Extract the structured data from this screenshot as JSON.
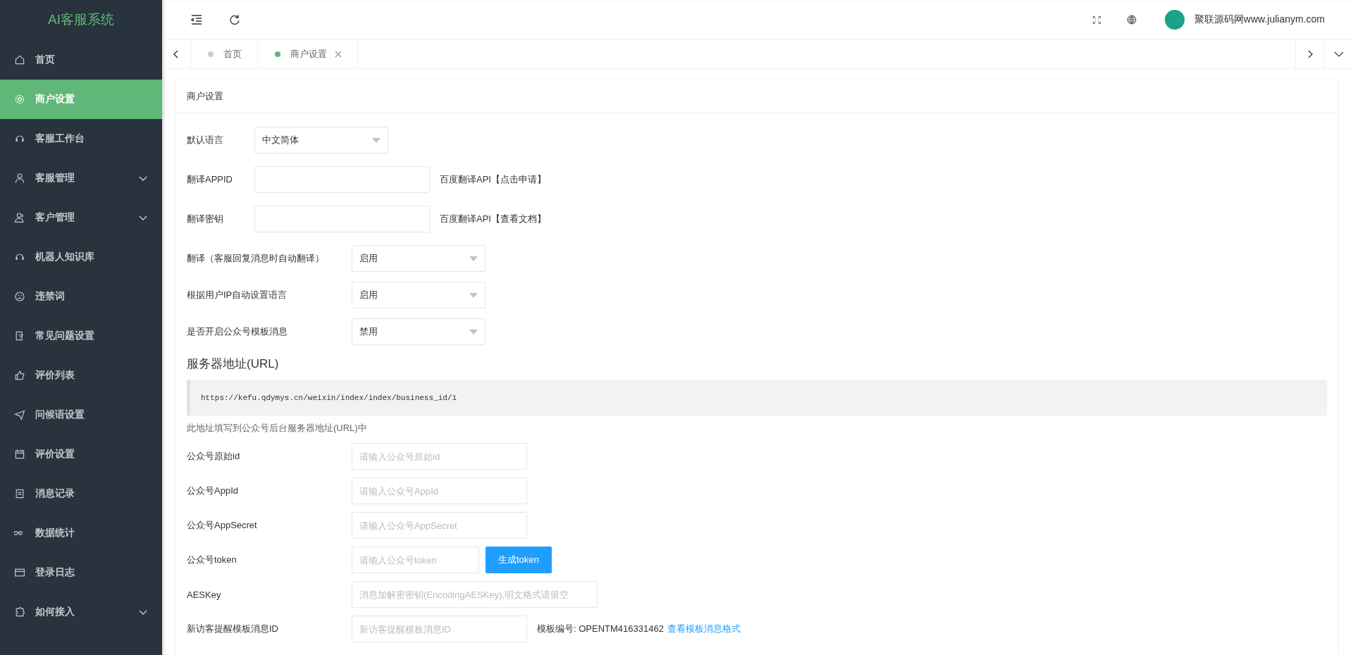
{
  "sidebar": {
    "title": "AI客服系统",
    "items": [
      {
        "label": "首页",
        "selected": false,
        "has_submenu": false
      },
      {
        "label": "商户设置",
        "selected": true,
        "has_submenu": false
      },
      {
        "label": "客服工作台",
        "selected": false,
        "has_submenu": false
      },
      {
        "label": "客服管理",
        "selected": false,
        "has_submenu": true
      },
      {
        "label": "客户管理",
        "selected": false,
        "has_submenu": true
      },
      {
        "label": "机器人知识库",
        "selected": false,
        "has_submenu": false
      },
      {
        "label": "违禁词",
        "selected": false,
        "has_submenu": false
      },
      {
        "label": "常见问题设置",
        "selected": false,
        "has_submenu": false
      },
      {
        "label": "评价列表",
        "selected": false,
        "has_submenu": false
      },
      {
        "label": "问候语设置",
        "selected": false,
        "has_submenu": false
      },
      {
        "label": "评价设置",
        "selected": false,
        "has_submenu": false
      },
      {
        "label": "消息记录",
        "selected": false,
        "has_submenu": false
      },
      {
        "label": "数据统计",
        "selected": false,
        "has_submenu": false
      },
      {
        "label": "登录日志",
        "selected": false,
        "has_submenu": false
      },
      {
        "label": "如何接入",
        "selected": false,
        "has_submenu": true
      }
    ]
  },
  "header": {
    "user_name": "聚联源码网www.julianym.com"
  },
  "tabs": [
    {
      "label": "首页",
      "selected": false,
      "closable": false
    },
    {
      "label": "商户设置",
      "selected": true,
      "closable": true
    }
  ],
  "card": {
    "title": "商户设置",
    "translation_settings": [
      {
        "kind": "select",
        "label": "默认语言",
        "value": "中文简体"
      },
      {
        "kind": "input",
        "label": "翻译APPID",
        "note": "百度翻译API【点击申请】"
      },
      {
        "kind": "input",
        "label": "翻译密钥",
        "note": "百度翻译API【查看文档】"
      }
    ],
    "toggle_settings": [
      {
        "label": "翻译（客服回复消息时自动翻译）",
        "value": "启用"
      },
      {
        "label": "根据用户IP自动设置语言",
        "value": "启用"
      },
      {
        "label": "是否开启公众号模板消息",
        "value": "禁用"
      }
    ],
    "server_url": {
      "heading": "服务器地址(URL)",
      "url": "https://kefu.qdymys.cn/weixin/index/index/business_id/1",
      "hint": "此地址填写到公众号后台服务器地址(URL)中"
    },
    "wechat_fields": [
      {
        "kind": "input",
        "label": "公众号原始id",
        "placeholder": "请输入公众号原始id"
      },
      {
        "kind": "input",
        "label": "公众号AppId",
        "placeholder": "请输入公众号AppId"
      },
      {
        "kind": "input",
        "label": "公众号AppSecret",
        "placeholder": "请输入公众号AppSecret"
      },
      {
        "kind": "input_button",
        "label": "公众号token",
        "placeholder": "请输入公众号token",
        "button": "生成token"
      },
      {
        "kind": "wide_input",
        "label": "AESKey",
        "placeholder": "消息加解密密钥(EncodingAESKey),明文格式请留空"
      },
      {
        "kind": "input_link",
        "label": "新访客提醒模板消息ID",
        "placeholder": "新访客提醒模板消息ID",
        "note": "模板编号: OPENTM416331462",
        "link": "查看模板消息格式"
      }
    ]
  }
}
